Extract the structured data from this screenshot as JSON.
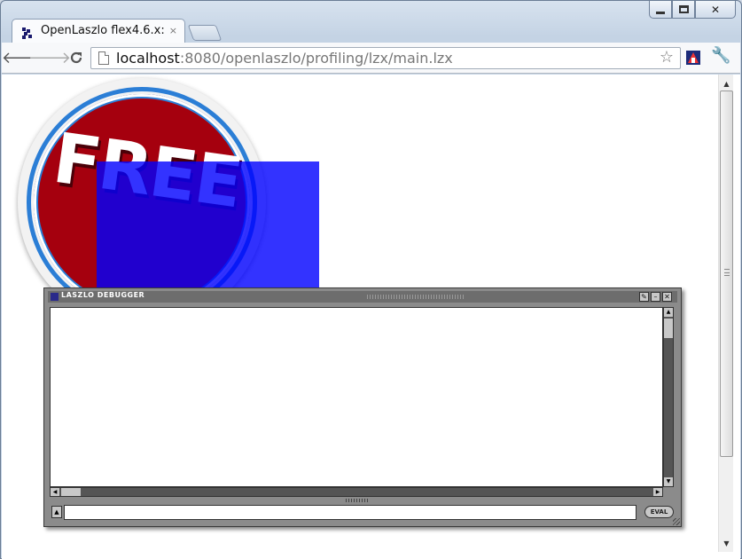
{
  "browser": {
    "tab": {
      "title": "OpenLaszlo flex4.6.x:",
      "close_label": "×"
    },
    "url": {
      "host": "localhost",
      "rest": ":8080/openlaszlo/profiling/lzx/main.lzx"
    }
  },
  "content": {
    "badge_text": "FREE"
  },
  "debugger": {
    "title": "LASZLO DEBUGGER",
    "eval_label": "EVAL",
    "input_value": ""
  },
  "colors": {
    "badge_red": "#a5000e",
    "badge_ring": "#2b7ed6",
    "overlay_blue": "#3333ff",
    "debugger_frame": "#8b8b8b"
  }
}
